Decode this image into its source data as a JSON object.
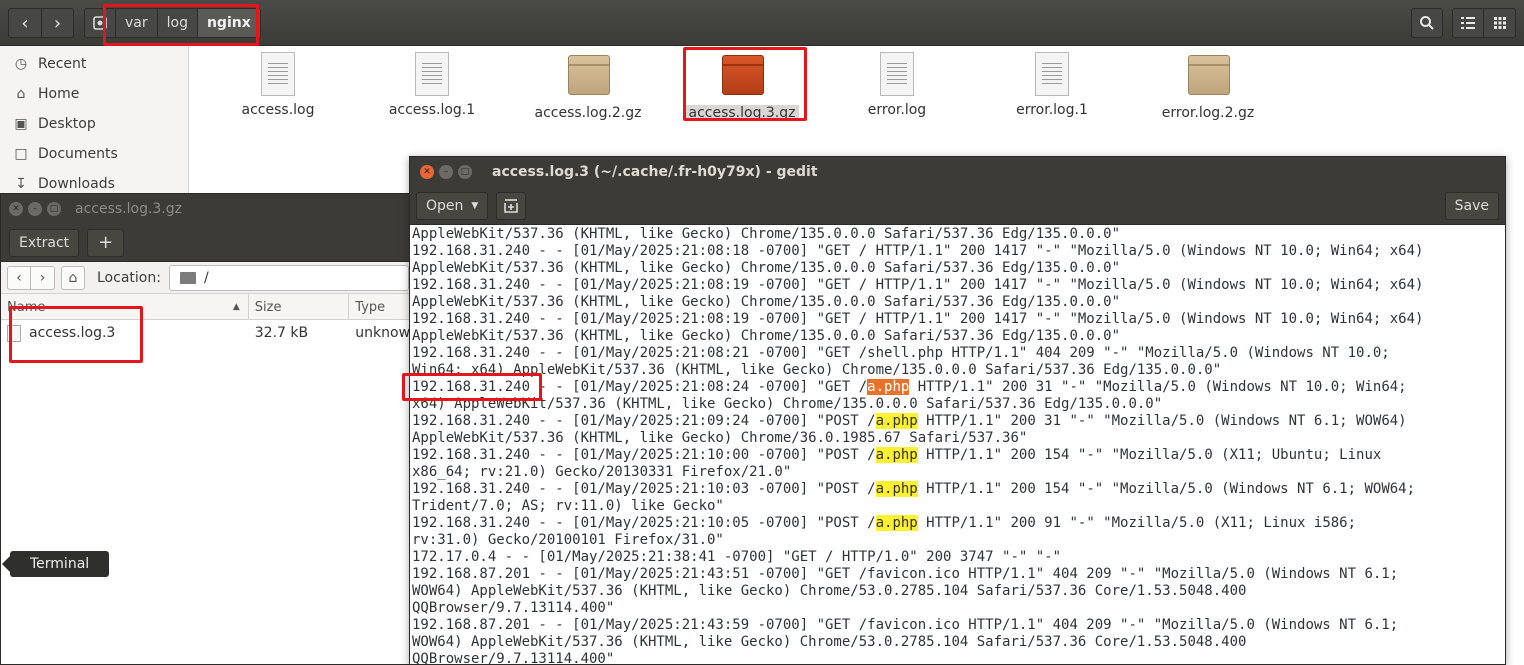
{
  "nautilus": {
    "breadcrumbs": [
      "var",
      "log",
      "nginx"
    ],
    "sidebar": [
      {
        "label": "Recent",
        "icon": "clock-icon"
      },
      {
        "label": "Home",
        "icon": "home-icon"
      },
      {
        "label": "Desktop",
        "icon": "folder-icon"
      },
      {
        "label": "Documents",
        "icon": "document-icon"
      },
      {
        "label": "Downloads",
        "icon": "download-icon"
      }
    ],
    "files": [
      {
        "name": "access.log",
        "icon": "text-file-icon"
      },
      {
        "name": "access.log.1",
        "icon": "text-file-icon"
      },
      {
        "name": "access.log.2.gz",
        "icon": "archive-icon"
      },
      {
        "name": "access.log.3.gz",
        "icon": "archive-icon",
        "selected": true
      },
      {
        "name": "error.log",
        "icon": "text-file-icon"
      },
      {
        "name": "error.log.1",
        "icon": "text-file-icon"
      },
      {
        "name": "error.log.2.gz",
        "icon": "archive-icon"
      }
    ]
  },
  "roller": {
    "title": "access.log.3.gz",
    "extract_label": "Extract",
    "add_label": "+",
    "location_label": "Location:",
    "location_value": "/",
    "columns": {
      "name": "Name",
      "size": "Size",
      "type": "Type"
    },
    "rows": [
      {
        "name": "access.log.3",
        "size": "32.7 kB",
        "type": "unknow"
      }
    ]
  },
  "tooltip": "Terminal",
  "gedit": {
    "title": "access.log.3 (~/.cache/.fr-h0y79x) - gedit",
    "open_label": "Open",
    "save_label": "Save",
    "search_highlight": "a.php",
    "lines": [
      "AppleWebKit/537.36 (KHTML, like Gecko) Chrome/135.0.0.0 Safari/537.36 Edg/135.0.0.0\"",
      "192.168.31.240 - - [01/May/2025:21:08:18 -0700] \"GET / HTTP/1.1\" 200 1417 \"-\" \"Mozilla/5.0 (Windows NT 10.0; Win64; x64)",
      "AppleWebKit/537.36 (KHTML, like Gecko) Chrome/135.0.0.0 Safari/537.36 Edg/135.0.0.0\"",
      "192.168.31.240 - - [01/May/2025:21:08:19 -0700] \"GET / HTTP/1.1\" 200 1417 \"-\" \"Mozilla/5.0 (Windows NT 10.0; Win64; x64)",
      "AppleWebKit/537.36 (KHTML, like Gecko) Chrome/135.0.0.0 Safari/537.36 Edg/135.0.0.0\"",
      "192.168.31.240 - - [01/May/2025:21:08:19 -0700] \"GET / HTTP/1.1\" 200 1417 \"-\" \"Mozilla/5.0 (Windows NT 10.0; Win64; x64)",
      "AppleWebKit/537.36 (KHTML, like Gecko) Chrome/135.0.0.0 Safari/537.36 Edg/135.0.0.0\"",
      "192.168.31.240 - - [01/May/2025:21:08:21 -0700] \"GET /shell.php HTTP/1.1\" 404 209 \"-\" \"Mozilla/5.0 (Windows NT 10.0;",
      "Win64; x64) AppleWebKit/537.36 (KHTML, like Gecko) Chrome/135.0.0.0 Safari/537.36 Edg/135.0.0.0\"",
      "192.168.31.240 - - [01/May/2025:21:08:24 -0700] \"GET /a.php HTTP/1.1\" 200 31 \"-\" \"Mozilla/5.0 (Windows NT 10.0; Win64;",
      "x64) AppleWebKit/537.36 (KHTML, like Gecko) Chrome/135.0.0.0 Safari/537.36 Edg/135.0.0.0\"",
      "192.168.31.240 - - [01/May/2025:21:09:24 -0700] \"POST /a.php HTTP/1.1\" 200 31 \"-\" \"Mozilla/5.0 (Windows NT 6.1; WOW64)",
      "AppleWebKit/537.36 (KHTML, like Gecko) Chrome/36.0.1985.67 Safari/537.36\"",
      "192.168.31.240 - - [01/May/2025:21:10:00 -0700] \"POST /a.php HTTP/1.1\" 200 154 \"-\" \"Mozilla/5.0 (X11; Ubuntu; Linux",
      "x86_64; rv:21.0) Gecko/20130331 Firefox/21.0\"",
      "192.168.31.240 - - [01/May/2025:21:10:03 -0700] \"POST /a.php HTTP/1.1\" 200 154 \"-\" \"Mozilla/5.0 (Windows NT 6.1; WOW64;",
      "Trident/7.0; AS; rv:11.0) like Gecko\"",
      "192.168.31.240 - - [01/May/2025:21:10:05 -0700] \"POST /a.php HTTP/1.1\" 200 91 \"-\" \"Mozilla/5.0 (X11; Linux i586;",
      "rv:31.0) Gecko/20100101 Firefox/31.0\"",
      "172.17.0.4 - - [01/May/2025:21:38:41 -0700] \"GET / HTTP/1.0\" 200 3747 \"-\" \"-\"",
      "192.168.87.201 - - [01/May/2025:21:43:51 -0700] \"GET /favicon.ico HTTP/1.1\" 404 209 \"-\" \"Mozilla/5.0 (Windows NT 6.1;",
      "WOW64) AppleWebKit/537.36 (KHTML, like Gecko) Chrome/53.0.2785.104 Safari/537.36 Core/1.53.5048.400",
      "QQBrowser/9.7.13114.400\"",
      "192.168.87.201 - - [01/May/2025:21:43:59 -0700] \"GET /favicon.ico HTTP/1.1\" 404 209 \"-\" \"Mozilla/5.0 (Windows NT 6.1;",
      "WOW64) AppleWebKit/537.36 (KHTML, like Gecko) Chrome/53.0.2785.104 Safari/537.36 Core/1.53.5048.400",
      "QQBrowser/9.7.13114.400\""
    ]
  },
  "colors": {
    "annotation_red": "#e3161d",
    "search_highlight": "#fff130",
    "current_match": "#e8722a",
    "titlebar": "#3c3b37"
  }
}
